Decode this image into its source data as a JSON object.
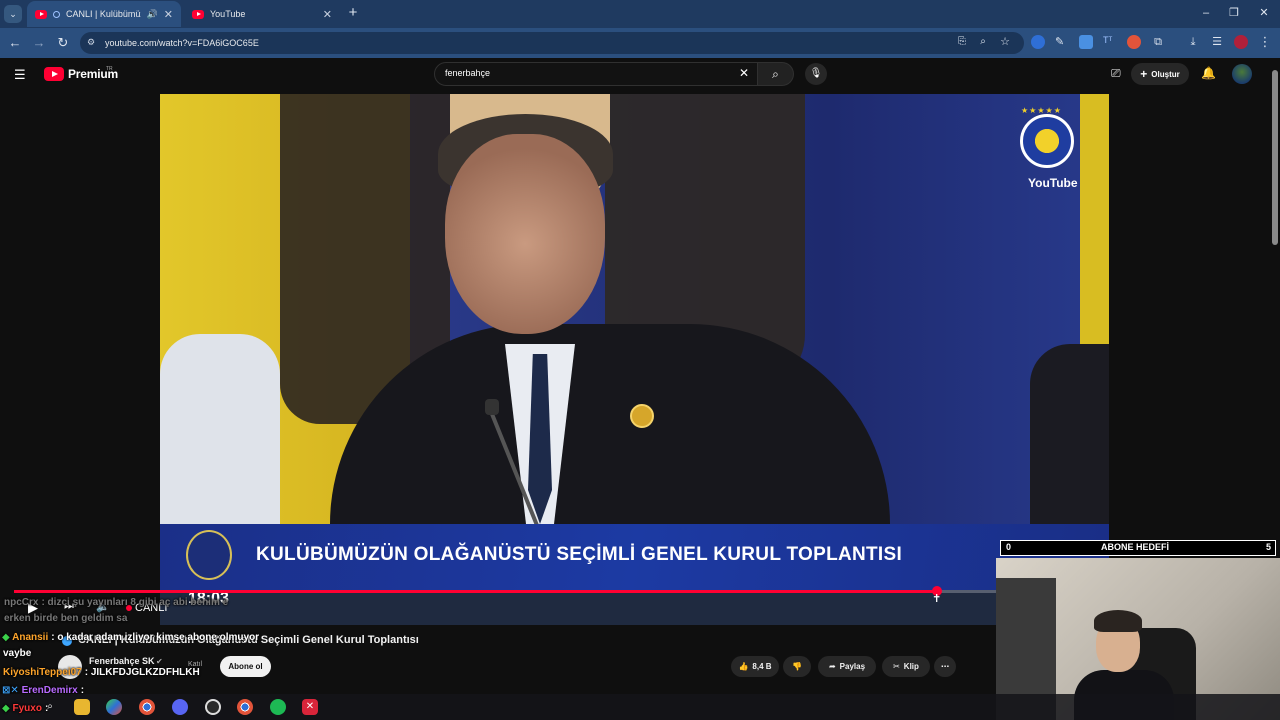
{
  "browser": {
    "tabs": [
      {
        "title": "CANLI | Kulübümüzün O",
        "active": true
      },
      {
        "title": "YouTube",
        "active": false
      }
    ],
    "url": "youtube.com/watch?v=FDA6iGOC65E",
    "window_controls": {
      "minimize": "–",
      "restore": "❐",
      "close": "✕"
    }
  },
  "youtube": {
    "logo_text": "Premium",
    "region": "TR",
    "search_value": "fenerbahçe",
    "create_label": "Oluştur"
  },
  "video": {
    "banner_title": "KULÜBÜMÜZÜN OLAĞANÜSTÜ SEÇİMLİ GENEL KURUL TOPLANTISI",
    "clock": "18:03",
    "watermark": "YouTube",
    "live_label": "CANLI",
    "progress_fraction": 0.94
  },
  "below_video": {
    "title": "CANLI | Kulübümüzün Olağanüstü Seçimli Genel Kurul Toplantısı",
    "channel_name": "Fenerbahçe SK",
    "channel_subs": "Katıl",
    "subscribe_label": "Abone ol",
    "likes": "8,4 B",
    "share_label": "Paylaş",
    "clip_label": "Klip",
    "more_label": "⋯"
  },
  "chat": [
    {
      "user": "npcCrx",
      "text": ": dizci şu yayınları 8 gibi aç abi benim e",
      "color": "#777777"
    },
    {
      "user": "",
      "text": "erken birde ben geldim sa",
      "color": "#777777"
    },
    {
      "user": "Anansii",
      "text": ": o kadar adam izliyor kimse abone olmuyor",
      "color": "#ffa52b"
    },
    {
      "user": "",
      "text": "vaybe",
      "color": "#ffffff"
    },
    {
      "user": "KiyoshiTeppei07",
      "text": ": JILKFDJGLKZDFHLKH",
      "color": "#ffa52b"
    },
    {
      "user": "ErenDemirx",
      "text": ":",
      "color": "#b86bff"
    },
    {
      "user": "Fyuxo",
      "text": ":",
      "color": "#ff3a3a"
    }
  ],
  "subscriber_goal": {
    "current": "0",
    "label": "ABONE HEDEFİ",
    "target": "5",
    "fraction": 0
  },
  "colors": {
    "chrome_tabstrip": "#1f3a60",
    "chrome_toolbar": "#2b4f7e",
    "youtube_red": "#ff0033",
    "yt_bg": "#0f0f0f"
  }
}
